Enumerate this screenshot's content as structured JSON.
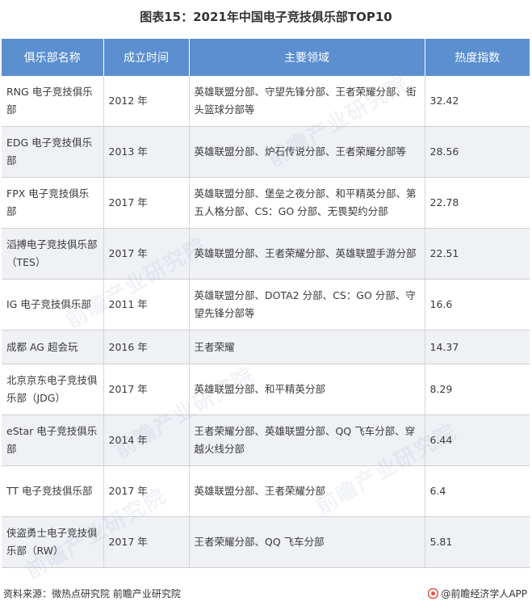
{
  "title": "图表15：2021年中国电子竞技俱乐部TOP10",
  "table": {
    "headers": [
      "俱乐部名称",
      "成立时间",
      "主要领域",
      "热度指数"
    ],
    "rows": [
      {
        "name": "RNG 电子竞技俱乐部",
        "year": "2012 年",
        "field": "英雄联盟分部、守望先锋分部、王者荣耀分部、街头篮球分部等",
        "heat": "32.42"
      },
      {
        "name": "EDG 电子竞技俱乐部",
        "year": "2013 年",
        "field": "英雄联盟分部、炉石传说分部、王者荣耀分部等",
        "heat": "28.56"
      },
      {
        "name": "FPX 电子竞技俱乐部",
        "year": "2017 年",
        "field": "英雄联盟分部、堡垒之夜分部、和平精英分部、第五人格分部、CS：GO 分部、无畏契约分部",
        "heat": "22.78"
      },
      {
        "name": "滔搏电子竞技俱乐部（TES）",
        "year": "2017 年",
        "field": "英雄联盟分部、王者荣耀分部、英雄联盟手游分部",
        "heat": "22.51"
      },
      {
        "name": "IG 电子竞技俱乐部",
        "year": "2011 年",
        "field": "英雄联盟分部、DOTA2 分部、CS：GO 分部、守望先锋分部等",
        "heat": "16.6"
      },
      {
        "name": "成都 AG 超会玩",
        "year": "2016 年",
        "field": "王者荣耀",
        "heat": "14.37"
      },
      {
        "name": "北京京东电子竞技俱乐部（JDG）",
        "year": "2017 年",
        "field": "英雄联盟分部、和平精英分部",
        "heat": "8.29"
      },
      {
        "name": "eStar 电子竞技俱乐部",
        "year": "2014 年",
        "field": "王者荣耀分部、英雄联盟分部、QQ 飞车分部、穿越火线分部",
        "heat": "6.44"
      },
      {
        "name": "TT 电子竞技俱乐部",
        "year": "2017 年",
        "field": "英雄联盟分部、王者荣耀分部",
        "heat": "6.4"
      },
      {
        "name": "侠盗勇士电子竞技俱乐部（RW）",
        "year": "2017 年",
        "field": "王者荣耀分部、QQ 飞车分部",
        "heat": "5.81"
      }
    ]
  },
  "footer": {
    "source": "资料来源：微热点研究院 前瞻产业研究院",
    "brand": "@前瞻经济学人APP"
  },
  "watermark": {
    "text": "前瞻产业研究院"
  },
  "colors": {
    "header_bg": "#5b8fd0",
    "row_alt_bg": "#eff1f5",
    "brand_icon": "#e84b3c"
  },
  "icons": {
    "brand": "brand-logo-icon"
  }
}
